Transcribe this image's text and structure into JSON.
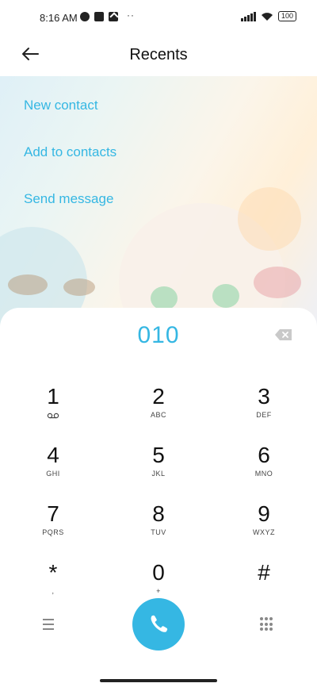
{
  "status_bar": {
    "time": "8:16 AM",
    "left_icons": [
      "notification-circle-icon",
      "app-square-icon",
      "upload-icon"
    ],
    "more": "··",
    "battery": "100",
    "right_icons": [
      "signal-icon",
      "wifi-icon",
      "battery-icon"
    ]
  },
  "header": {
    "title": "Recents",
    "back_icon": "arrow-left-icon"
  },
  "menu": {
    "items": [
      "New contact",
      "Add to contacts",
      "Send message"
    ]
  },
  "dialpad": {
    "number": "010",
    "backspace_icon": "backspace-icon",
    "keys": [
      {
        "digit": "1",
        "letters": "☷"
      },
      {
        "digit": "2",
        "letters": "ABC"
      },
      {
        "digit": "3",
        "letters": "DEF"
      },
      {
        "digit": "4",
        "letters": "GHI"
      },
      {
        "digit": "5",
        "letters": "JKL"
      },
      {
        "digit": "6",
        "letters": "MNO"
      },
      {
        "digit": "7",
        "letters": "PQRS"
      },
      {
        "digit": "8",
        "letters": "TUV"
      },
      {
        "digit": "9",
        "letters": "WXYZ"
      },
      {
        "digit": "*",
        "letters": ","
      },
      {
        "digit": "0",
        "letters": "+"
      },
      {
        "digit": "#",
        "letters": ""
      }
    ],
    "voicemail_icon": "voicemail-icon",
    "bottom": {
      "menu_icon": "hamburger-menu-icon",
      "call_icon": "phone-icon",
      "keypad_icon": "keypad-grid-icon"
    }
  },
  "colors": {
    "accent": "#35b7e3",
    "text": "#111111"
  }
}
